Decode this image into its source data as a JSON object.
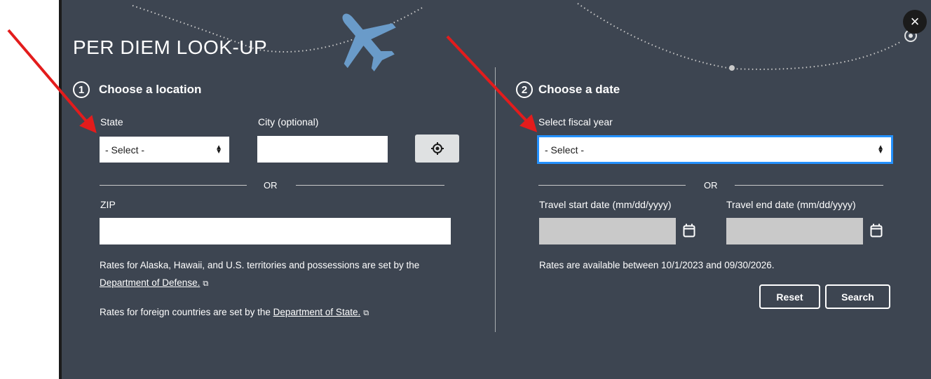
{
  "modal": {
    "title": "PER DIEM LOOK-UP",
    "close_label": "×"
  },
  "location": {
    "step": "1",
    "heading": "Choose a location",
    "state_label": "State",
    "state_value": "- Select -",
    "city_label": "City (optional)",
    "city_value": "",
    "or_label": "OR",
    "zip_label": "ZIP",
    "zip_value": "",
    "note1_text": "Rates for Alaska, Hawaii, and U.S. territories and possessions are set by the",
    "note1_link": "Department of Defense.",
    "note2_text": "Rates for foreign countries are set by the ",
    "note2_link": "Department of State."
  },
  "date": {
    "step": "2",
    "heading": "Choose a date",
    "fiscal_label": "Select fiscal year",
    "fiscal_value": "- Select -",
    "or_label": "OR",
    "start_label": "Travel start date (mm/dd/yyyy)",
    "end_label": "Travel end date (mm/dd/yyyy)",
    "availability": "Rates are available between 10/1/2023 and 09/30/2026.",
    "reset_label": "Reset",
    "search_label": "Search"
  },
  "colors": {
    "panel": "#3d4551",
    "arrow": "#e31c1c",
    "plane": "#6a9bc9",
    "focus": "#2491ff"
  }
}
